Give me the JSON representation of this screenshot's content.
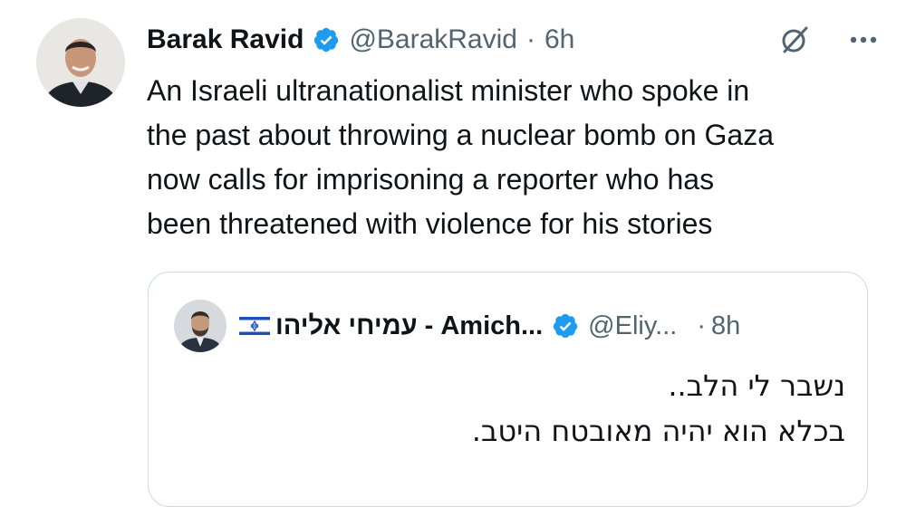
{
  "tweet": {
    "author_name": "Barak Ravid",
    "handle": "@BarakRavid",
    "separator": "·",
    "time": "6h",
    "text_lines": [
      "An Israeli ultranationalist minister who spoke in",
      "the past about throwing a nuclear bomb on Gaza",
      "now calls for imprisoning a reporter who has",
      "been threatened with violence for his stories"
    ]
  },
  "quote": {
    "author_name": "עמיחי אליהו - Amich...",
    "handle": "@Eliy...",
    "separator": "·",
    "time": "8h",
    "text_lines": [
      "נשבר לי הלב..",
      "בכלא הוא יהיה מאובטח היטב."
    ]
  },
  "icons": {
    "verified": "verified-badge-icon",
    "grok": "grok-icon",
    "more": "more-options-icon",
    "flag": "israel-flag-icon"
  },
  "colors": {
    "verified_blue": "#1d9bf0",
    "text_primary": "#0f1419",
    "text_secondary": "#536471",
    "card_border": "#cfd9de"
  }
}
